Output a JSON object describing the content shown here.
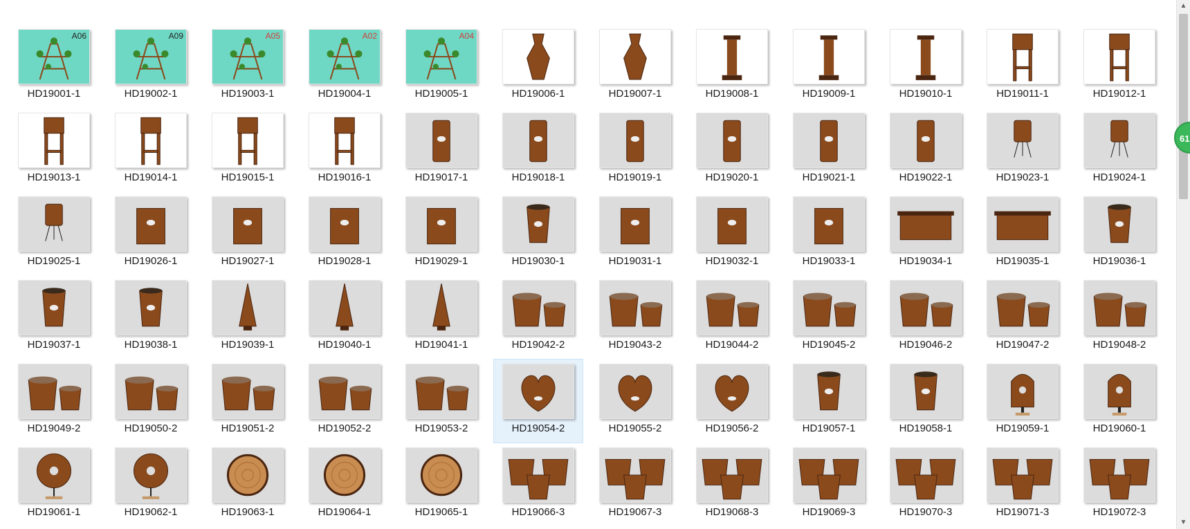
{
  "columns": 12,
  "selected_item": "HD19054-2",
  "items": [
    {
      "label": "HD19001-1",
      "kind": "stand",
      "tag": "A06"
    },
    {
      "label": "HD19002-1",
      "kind": "stand",
      "tag": "A09"
    },
    {
      "label": "HD19003-1",
      "kind": "stand",
      "tag": "A05"
    },
    {
      "label": "HD19004-1",
      "kind": "stand",
      "tag": "A02"
    },
    {
      "label": "HD19005-1",
      "kind": "stand",
      "tag": "A04"
    },
    {
      "label": "HD19006-1",
      "kind": "vase"
    },
    {
      "label": "HD19007-1",
      "kind": "vase"
    },
    {
      "label": "HD19008-1",
      "kind": "pillar"
    },
    {
      "label": "HD19009-1",
      "kind": "pillar"
    },
    {
      "label": "HD19010-1",
      "kind": "pillar"
    },
    {
      "label": "HD19011-1",
      "kind": "tallstand"
    },
    {
      "label": "HD19012-1",
      "kind": "tallstand"
    },
    {
      "label": "HD19013-1",
      "kind": "tallstand"
    },
    {
      "label": "HD19014-1",
      "kind": "tallstand"
    },
    {
      "label": "HD19015-1",
      "kind": "tallstand"
    },
    {
      "label": "HD19016-1",
      "kind": "tallstand"
    },
    {
      "label": "HD19017-1",
      "kind": "cylinder"
    },
    {
      "label": "HD19018-1",
      "kind": "cylinder"
    },
    {
      "label": "HD19019-1",
      "kind": "cylinder"
    },
    {
      "label": "HD19020-1",
      "kind": "cylinder"
    },
    {
      "label": "HD19021-1",
      "kind": "cylinder"
    },
    {
      "label": "HD19022-1",
      "kind": "cylinder"
    },
    {
      "label": "HD19023-1",
      "kind": "potlegs"
    },
    {
      "label": "HD19024-1",
      "kind": "potlegs"
    },
    {
      "label": "HD19025-1",
      "kind": "potlegs"
    },
    {
      "label": "HD19026-1",
      "kind": "box"
    },
    {
      "label": "HD19027-1",
      "kind": "box"
    },
    {
      "label": "HD19028-1",
      "kind": "box"
    },
    {
      "label": "HD19029-1",
      "kind": "box"
    },
    {
      "label": "HD19030-1",
      "kind": "pot"
    },
    {
      "label": "HD19031-1",
      "kind": "box"
    },
    {
      "label": "HD19032-1",
      "kind": "box"
    },
    {
      "label": "HD19033-1",
      "kind": "box"
    },
    {
      "label": "HD19034-1",
      "kind": "planter"
    },
    {
      "label": "HD19035-1",
      "kind": "planter"
    },
    {
      "label": "HD19036-1",
      "kind": "pot"
    },
    {
      "label": "HD19037-1",
      "kind": "pot"
    },
    {
      "label": "HD19038-1",
      "kind": "pot"
    },
    {
      "label": "HD19039-1",
      "kind": "cone"
    },
    {
      "label": "HD19040-1",
      "kind": "cone"
    },
    {
      "label": "HD19041-1",
      "kind": "cone"
    },
    {
      "label": "HD19042-2",
      "kind": "pair"
    },
    {
      "label": "HD19043-2",
      "kind": "pair"
    },
    {
      "label": "HD19044-2",
      "kind": "pair"
    },
    {
      "label": "HD19045-2",
      "kind": "pair"
    },
    {
      "label": "HD19046-2",
      "kind": "pair"
    },
    {
      "label": "HD19047-2",
      "kind": "pair"
    },
    {
      "label": "HD19048-2",
      "kind": "pair"
    },
    {
      "label": "HD19049-2",
      "kind": "pair"
    },
    {
      "label": "HD19050-2",
      "kind": "pair"
    },
    {
      "label": "HD19051-2",
      "kind": "pair"
    },
    {
      "label": "HD19052-2",
      "kind": "pair"
    },
    {
      "label": "HD19053-2",
      "kind": "pair"
    },
    {
      "label": "HD19054-2",
      "kind": "heart"
    },
    {
      "label": "HD19055-2",
      "kind": "heart"
    },
    {
      "label": "HD19056-2",
      "kind": "heart"
    },
    {
      "label": "HD19057-1",
      "kind": "pot"
    },
    {
      "label": "HD19058-1",
      "kind": "pot"
    },
    {
      "label": "HD19059-1",
      "kind": "decor"
    },
    {
      "label": "HD19060-1",
      "kind": "decor"
    },
    {
      "label": "HD19061-1",
      "kind": "ring"
    },
    {
      "label": "HD19062-1",
      "kind": "ring"
    },
    {
      "label": "HD19063-1",
      "kind": "slice"
    },
    {
      "label": "HD19064-1",
      "kind": "slice"
    },
    {
      "label": "HD19065-1",
      "kind": "slice"
    },
    {
      "label": "HD19066-3",
      "kind": "trio"
    },
    {
      "label": "HD19067-3",
      "kind": "trio"
    },
    {
      "label": "HD19068-3",
      "kind": "trio"
    },
    {
      "label": "HD19069-3",
      "kind": "trio"
    },
    {
      "label": "HD19070-3",
      "kind": "trio"
    },
    {
      "label": "HD19071-3",
      "kind": "trio"
    },
    {
      "label": "HD19072-3",
      "kind": "trio"
    }
  ],
  "side_badge": {
    "text": "61",
    "color": "#3bb85a"
  },
  "colors": {
    "wood": "#8a4a1c",
    "wood_dark": "#4a2510",
    "bg_mint": "#6fd8c4",
    "bg_gray": "#dcdcdc",
    "selection": "#e5f1fb"
  }
}
